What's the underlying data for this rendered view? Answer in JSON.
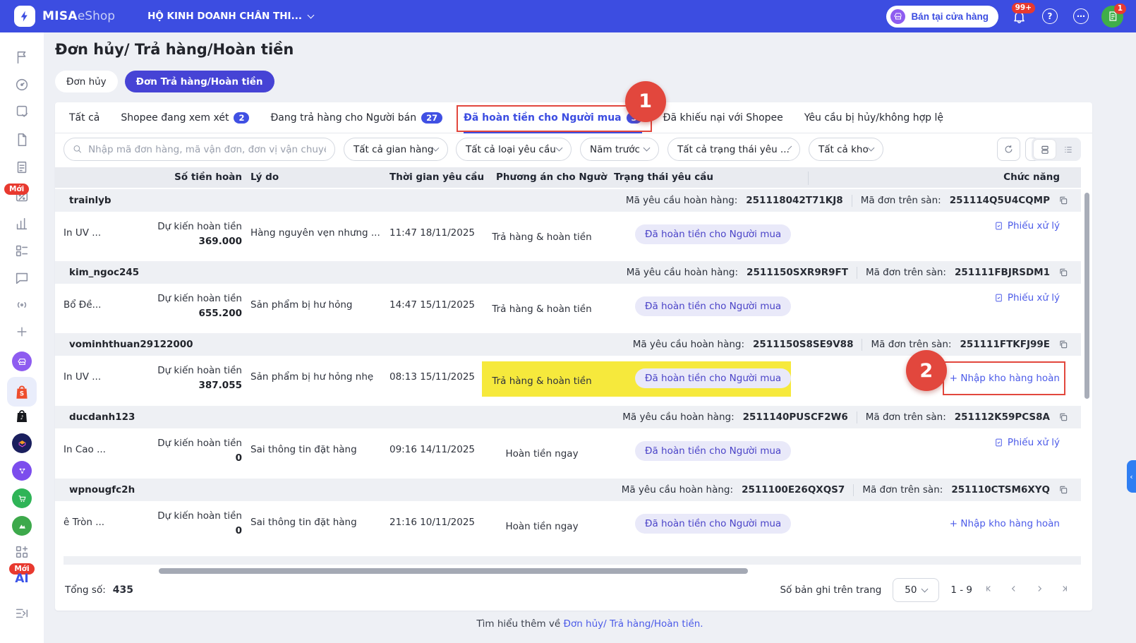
{
  "topbar": {
    "brand_bold": "MISA",
    "brand_light": "eShop",
    "store_name": "HỘ KINH DOANH CHÂN THI...",
    "sell_button": "Bán tại cửa hàng",
    "notification_count": "99+",
    "profile_badge": "1",
    "help_glyph": "?",
    "more_glyph": "⋯"
  },
  "page": {
    "title": "Đơn hủy/ Trả hàng/Hoàn tiền",
    "pill_cancel": "Đơn hủy",
    "pill_return": "Đơn Trả hàng/Hoàn tiền"
  },
  "tabs": {
    "all": "Tất cả",
    "reviewing": "Shopee đang xem xét",
    "reviewing_count": "2",
    "returning": "Đang trả hàng cho Người bán",
    "returning_count": "27",
    "refunded": "Đã hoàn tiền cho Người mua",
    "refunded_count": "3",
    "complained": "Đã khiếu nại với Shopee",
    "cancelled": "Yêu cầu bị hủy/không hợp lệ"
  },
  "filters": {
    "search_placeholder": "Nhập mã đơn hàng, mã vận đơn, đơn vị vận chuyển",
    "store": "Tất cả gian hàng",
    "request_type": "Tất cả loại yêu cầu",
    "time": "Năm trước",
    "status": "Tất cả trạng thái yêu ...",
    "warehouse": "Tất cả kho"
  },
  "table": {
    "headers": {
      "amount": "Số tiền hoàn",
      "reason": "Lý do",
      "time": "Thời gian yêu cầu",
      "buyer_option": "Phương án cho Người mua",
      "status": "Trạng thái yêu cầu",
      "actions": "Chức năng"
    },
    "labels": {
      "request_code": "Mã yêu cầu hoàn hàng:",
      "order_code": "Mã đơn trên sàn:",
      "expected_refund": "Dự kiến hoàn tiền",
      "status_refunded": "Đã hoàn tiền cho Người mua",
      "action_slip": "Phiếu xử lý",
      "action_receive": "+ Nhập kho hàng hoàn"
    },
    "rows": [
      {
        "seller": "trainlyb",
        "request_code": "251118042T71KJ8",
        "order_code": "251114Q5U4CQMP",
        "product": "In UV ...",
        "amount": "369.000",
        "reason": "Hàng nguyên vẹn nhưng ...",
        "time": "11:47 18/11/2025",
        "method": "Trả hàng & hoàn tiền"
      },
      {
        "seller": "kim_ngoc245",
        "request_code": "2511150SXR9R9FT",
        "order_code": "251111FBJRSDM1",
        "product": "Bổ Đề...",
        "amount": "655.200",
        "reason": "Sản phẩm bị hư hỏng",
        "time": "14:47 15/11/2025",
        "method": "Trả hàng & hoàn tiền"
      },
      {
        "seller": "vominhthuan29122000",
        "request_code": "2511150S8SE9V88",
        "order_code": "251111FTKFJ99E",
        "product": "In UV ...",
        "amount": "387.055",
        "reason": "Sản phẩm bị hư hỏng nhẹ",
        "time": "08:13 15/11/2025",
        "method": "Trả hàng & hoàn tiền"
      },
      {
        "seller": "ducdanh123",
        "request_code": "2511140PUSCF2W6",
        "order_code": "251112K59PCS8A",
        "product": "In Cao ...",
        "amount": "0",
        "reason": "Sai thông tin đặt hàng",
        "time": "09:16 14/11/2025",
        "method": "Hoàn tiền ngay"
      },
      {
        "seller": "wpnougfc2h",
        "request_code": "2511100E26QXQS7",
        "order_code": "251110CTSM6XYQ",
        "product": "ê Tròn ...",
        "amount": "0",
        "reason": "Sai thông tin đặt hàng",
        "time": "21:16 10/11/2025",
        "method": "Hoàn tiền ngay"
      }
    ]
  },
  "pagination": {
    "total_label": "Tổng số:",
    "total": "435",
    "per_page_label": "Số bản ghi trên trang",
    "per_page": "50",
    "range": "1 - 9"
  },
  "footer": {
    "prefix": "Tìm hiểu thêm về",
    "link": "Đơn hủy/ Trả hàng/Hoàn tiền."
  },
  "annotations": {
    "step1": "1",
    "step2": "2"
  },
  "sidebar": {
    "new_badge": "Mới",
    "ai_label": "AI"
  }
}
